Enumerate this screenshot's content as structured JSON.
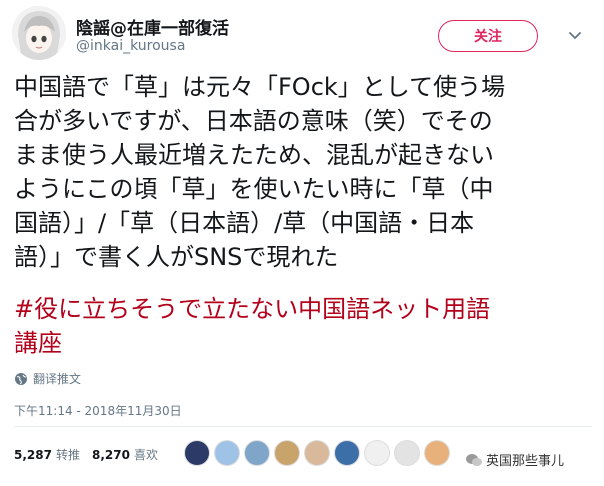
{
  "user": {
    "display_name": "陰謡@在庫一部復活",
    "handle": "@inkai_kurousa"
  },
  "follow_label": "关注",
  "tweet_lines": [
    "中国語で「草」は元々「FOck」として使う場",
    "合が多いですが、日本語の意味（笑）でその",
    "まま使う人最近増えたため、混乱が起きない",
    "ようにこの頃「草」を使いたい時に「草（中",
    "国語）」/「草（日本語）/草（中国語・日本",
    "語）」で書く人がSNSで現れた"
  ],
  "hashtag_lines": [
    "#役に立ちそうで立たない中国語ネット用語",
    "講座"
  ],
  "translate_label": "翻译推文",
  "timestamp": "下午11:14 - 2018年11月30日",
  "stats": {
    "retweets_count": "5,287",
    "retweets_label": "转推",
    "likes_count": "8,270",
    "likes_label": "喜欢"
  },
  "liker_avatars": [
    "#2b3a67",
    "#9ec3e6",
    "#7fa6c9",
    "#c8a36a",
    "#d9b99b",
    "#3c6fa8",
    "#f0f0f0",
    "#e3e3e3",
    "#e8b07a"
  ],
  "watermark": "英国那些事儿",
  "colors": {
    "follow": "#e0245e",
    "hashtag": "#b3001b",
    "meta": "#657786"
  }
}
